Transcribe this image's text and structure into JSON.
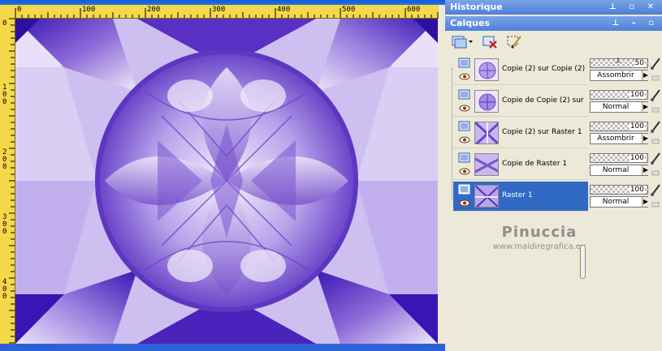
{
  "canvas": {
    "ruler_top_labels": [
      "0",
      "100",
      "200",
      "300",
      "400",
      "500",
      "600"
    ],
    "ruler_left_labels": [
      "0",
      "1\n0\n0",
      "2\n0\n0",
      "3\n0\n0",
      "4\n0\n0"
    ]
  },
  "panels": {
    "history_title": "Historique",
    "layers_title": "Calques"
  },
  "toolbar": {
    "new_layer_icon": "new-layer-icon",
    "delete_layer_icon": "delete-layer-icon",
    "edit_selection_icon": "edit-selection-icon"
  },
  "layers": [
    {
      "name": "Copie (2) sur Copie (2)",
      "opacity": "50",
      "blend": "Assombrir",
      "selected": false
    },
    {
      "name": "Copie de Copie (2) sur",
      "opacity": "100",
      "blend": "Normal",
      "selected": false
    },
    {
      "name": "Copie (2) sur Raster 1",
      "opacity": "100",
      "blend": "Assombrir",
      "selected": false
    },
    {
      "name": "Copie de Raster 1",
      "opacity": "100",
      "blend": "Normal",
      "selected": false
    },
    {
      "name": "Raster 1",
      "opacity": "100",
      "blend": "Normal",
      "selected": true
    }
  ],
  "watermark": {
    "name": "Pinuccia",
    "url": "www.maidiregrafica.eu"
  },
  "colors": {
    "selected": "#316ac5",
    "titlebar": "#5a87dc",
    "ruler": "#f4d84a",
    "purple_dark": "#3a1aa0",
    "purple_light": "#e4dcf7"
  }
}
